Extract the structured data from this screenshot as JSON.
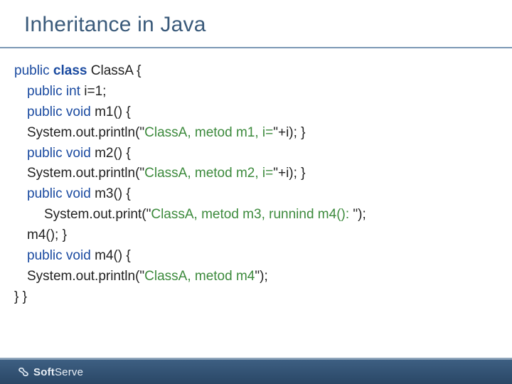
{
  "title": "Inheritance in Java",
  "code": {
    "l1": {
      "a": "public ",
      "b": "class ",
      "c": "ClassA {"
    },
    "l2": {
      "a": "public int ",
      "b": "i=1;"
    },
    "l3": {
      "a": "public void ",
      "b": "m1() {"
    },
    "l4": {
      "a": "System.out.println(\"",
      "b": "ClassA, metod m1, i=",
      "c": "\"+i);  }"
    },
    "l5": {
      "a": "public void ",
      "b": "m2() {"
    },
    "l6": {
      "a": "System.out.println(\"",
      "b": "ClassA, metod m2, i=",
      "c": "\"+i);  }"
    },
    "l7": {
      "a": "public void ",
      "b": "m3() {"
    },
    "l8": {
      "a": "System.out.print(\"",
      "b": "ClassA, metod m3, runnind m4(): ",
      "c": "\");"
    },
    "l9": {
      "a": "m4();  }"
    },
    "l10": {
      "a": "public void ",
      "b": "m4() {"
    },
    "l11": {
      "a": "System.out.println(\"",
      "b": "ClassA, metod m4",
      "c": "\");"
    },
    "l12": {
      "a": "}   }"
    }
  },
  "footer": {
    "brand_a": "Soft",
    "brand_b": "Serve"
  }
}
